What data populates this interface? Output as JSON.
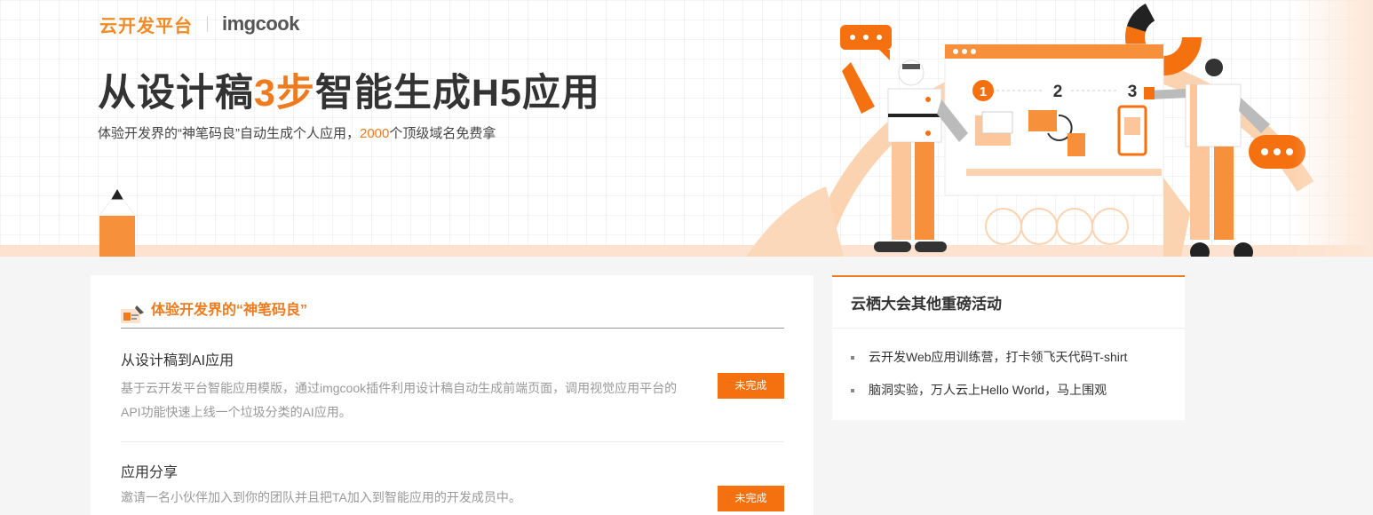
{
  "header": {
    "brand_cn": "云开发平台",
    "brand_en": "imgcook",
    "title_part1": "从设计稿",
    "title_highlight": "3步",
    "title_part2": "智能生成H5应用",
    "subtitle_part1": "体验开发界的“神笔码良”自动生成个人应用，",
    "subtitle_highlight": "2000",
    "subtitle_part2": "个顶级域名免费拿",
    "steps": [
      "1",
      "2",
      "3"
    ]
  },
  "main": {
    "section_title": "体验开发界的“神笔码良”",
    "tasks": [
      {
        "title": "从设计稿到AI应用",
        "description": "基于云开发平台智能应用模版，通过imgcook插件利用设计稿自动生成前端页面，调用视觉应用平台的API功能快速上线一个垃圾分类的AI应用。",
        "status": "未完成"
      },
      {
        "title": "应用分享",
        "description": "邀请一名小伙伴加入到你的团队并且把TA加入到智能应用的开发成员中。",
        "status": "未完成"
      }
    ]
  },
  "sidebar": {
    "title": "云栖大会其他重磅活动",
    "items": [
      "云开发Web应用训练营，打卡领飞天代码T-shirt",
      "脑洞实验，万人云上Hello World，马上围观"
    ]
  },
  "colors": {
    "accent": "#f07a1e",
    "button": "#f5700f",
    "illustration_light": "#fcc59a"
  }
}
